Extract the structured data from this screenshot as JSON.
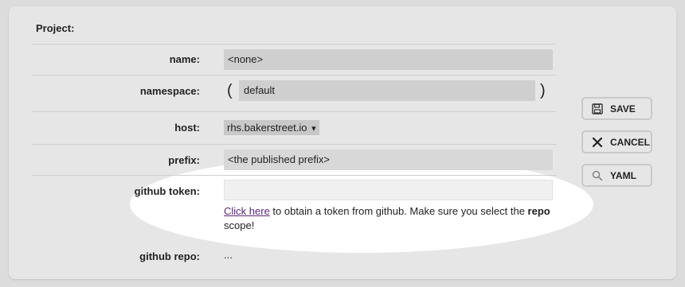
{
  "section_title": "Project:",
  "fields": {
    "name": {
      "label": "name:",
      "value": "<none>"
    },
    "namespace": {
      "label": "namespace:",
      "value": "default",
      "open_paren": "(",
      "close_paren": ")"
    },
    "host": {
      "label": "host:",
      "value": "rhs.bakerstreet.io",
      "caret": "▾"
    },
    "prefix": {
      "label": "prefix:",
      "value": "<the published prefix>"
    },
    "github_token": {
      "label": "github token:",
      "value": ""
    },
    "github_repo": {
      "label": "github repo:",
      "value": "..."
    }
  },
  "help": {
    "link_text": "Click here",
    "text_1": " to obtain a token from github. Make sure you select the ",
    "bold": "repo",
    "text_2": " scope!"
  },
  "buttons": {
    "save": {
      "label": "SAVE",
      "icon": "floppy-icon"
    },
    "cancel": {
      "label": "CANCEL",
      "icon": "close-icon"
    },
    "yaml": {
      "label": "YAML",
      "icon": "search-icon"
    }
  }
}
